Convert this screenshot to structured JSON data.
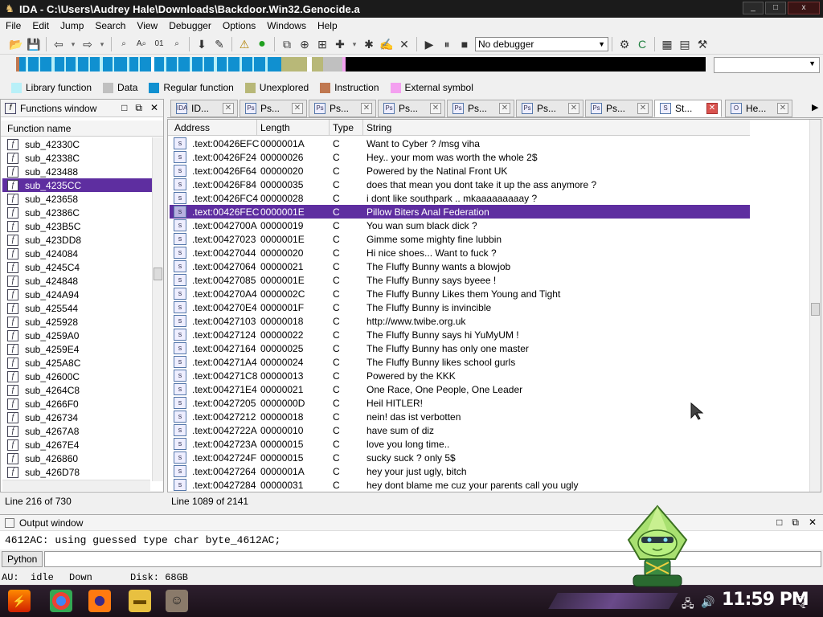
{
  "window": {
    "title": "IDA - C:\\Users\\Audrey Hale\\Downloads\\Backdoor.Win32.Genocide.a",
    "controls": [
      "_",
      "□",
      "x"
    ]
  },
  "menu": [
    "File",
    "Edit",
    "Jump",
    "Search",
    "View",
    "Debugger",
    "Options",
    "Windows",
    "Help"
  ],
  "toolbar": {
    "debugger_select": "No debugger"
  },
  "legend": [
    {
      "label": "Library function",
      "color": "#b8f0f8"
    },
    {
      "label": "Data",
      "color": "#c0c0c0"
    },
    {
      "label": "Regular function",
      "color": "#1090d0"
    },
    {
      "label": "Unexplored",
      "color": "#b8b878"
    },
    {
      "label": "Instruction",
      "color": "#c07850"
    },
    {
      "label": "External symbol",
      "color": "#f4a0f0"
    }
  ],
  "functions_window": {
    "title": "Functions window",
    "column": "Function name",
    "items": [
      "sub_42330C",
      "sub_42338C",
      "sub_423488",
      "sub_4235CC",
      "sub_423658",
      "sub_42386C",
      "sub_423B5C",
      "sub_423DD8",
      "sub_424084",
      "sub_4245C4",
      "sub_424848",
      "sub_424A94",
      "sub_425544",
      "sub_425928",
      "sub_4259A0",
      "sub_4259E4",
      "sub_425A8C",
      "sub_42600C",
      "sub_4264C8",
      "sub_4266F0",
      "sub_426734",
      "sub_4267A8",
      "sub_4267E4",
      "sub_426860",
      "sub_426D78"
    ],
    "selected_index": 3,
    "status": "Line 216 of 730"
  },
  "tabs": [
    {
      "label": "ID...",
      "icon": "IDA"
    },
    {
      "label": "Ps...",
      "icon": "Ps"
    },
    {
      "label": "Ps...",
      "icon": "Ps"
    },
    {
      "label": "Ps...",
      "icon": "Ps"
    },
    {
      "label": "Ps...",
      "icon": "Ps"
    },
    {
      "label": "Ps...",
      "icon": "Ps"
    },
    {
      "label": "Ps...",
      "icon": "Ps"
    },
    {
      "label": "St...",
      "icon": "S",
      "active": true
    },
    {
      "label": "He...",
      "icon": "O"
    }
  ],
  "strings_window": {
    "columns": [
      "Address",
      "Length",
      "Type",
      "String"
    ],
    "selected_index": 5,
    "rows": [
      [
        ".text:00426EFC",
        "0000001A",
        "C",
        "Want to Cyber ? /msg viha"
      ],
      [
        ".text:00426F24",
        "00000026",
        "C",
        "Hey.. your mom was worth the whole 2$"
      ],
      [
        ".text:00426F64",
        "00000020",
        "C",
        "Powered by the Natinal Front UK"
      ],
      [
        ".text:00426F84",
        "00000035",
        "C",
        "does that mean you dont take it up the ass anymore ?"
      ],
      [
        ".text:00426FC4",
        "00000028",
        "C",
        "i dont like southpark .. mkaaaaaaaaay ?"
      ],
      [
        ".text:00426FEC",
        "0000001E",
        "C",
        "Pillow Biters Anal Federation"
      ],
      [
        ".text:0042700A",
        "00000019",
        "C",
        "You wan sum black dick ?"
      ],
      [
        ".text:00427023",
        "0000001E",
        "C",
        "Gimme some mighty fine lubbin"
      ],
      [
        ".text:00427044",
        "00000020",
        "C",
        "Hi nice shoes... Want to fuck ?"
      ],
      [
        ".text:00427064",
        "00000021",
        "C",
        "The Fluffy Bunny wants a blowjob"
      ],
      [
        ".text:00427085",
        "0000001E",
        "C",
        "The Fluffy Bunny says byeee !"
      ],
      [
        ".text:004270A4",
        "0000002C",
        "C",
        "The Fluffy Bunny Likes them Young and Tight"
      ],
      [
        ".text:004270E4",
        "0000001F",
        "C",
        "The Fluffy Bunny is invincible"
      ],
      [
        ".text:00427103",
        "00000018",
        "C",
        "http://www.twibe.org.uk"
      ],
      [
        ".text:00427124",
        "00000022",
        "C",
        "The Fluffy Bunny says hi YuMyUM !"
      ],
      [
        ".text:00427164",
        "00000025",
        "C",
        "The Fluffy Bunny has only one master"
      ],
      [
        ".text:004271A4",
        "00000024",
        "C",
        "The Fluffy Bunny likes school gurls"
      ],
      [
        ".text:004271C8",
        "00000013",
        "C",
        "Powered by the KKK"
      ],
      [
        ".text:004271E4",
        "00000021",
        "C",
        "One Race, One People, One Leader"
      ],
      [
        ".text:00427205",
        "0000000D",
        "C",
        "Heil HITLER!"
      ],
      [
        ".text:00427212",
        "00000018",
        "C",
        "nein! das ist verbotten"
      ],
      [
        ".text:0042722A",
        "00000010",
        "C",
        "have sum of diz"
      ],
      [
        ".text:0042723A",
        "00000015",
        "C",
        "love you long time.."
      ],
      [
        ".text:0042724F",
        "00000015",
        "C",
        "sucky suck ? only 5$"
      ],
      [
        ".text:00427264",
        "0000001A",
        "C",
        "hey your just ugly, bitch"
      ],
      [
        ".text:00427284",
        "00000031",
        "C",
        "hey dont blame me cuz your parents call you ugly"
      ]
    ],
    "status": "Line 1089 of 2141"
  },
  "output_window": {
    "title": "Output window",
    "text": "4612AC: using guessed type char byte_4612AC;",
    "python_button": "Python"
  },
  "statusbar": {
    "au": "AU:",
    "state": "idle",
    "direction": "Down",
    "disk": "Disk: 68GB"
  },
  "taskbar": {
    "clock": "11:59 PM",
    "notification_count": "1"
  }
}
